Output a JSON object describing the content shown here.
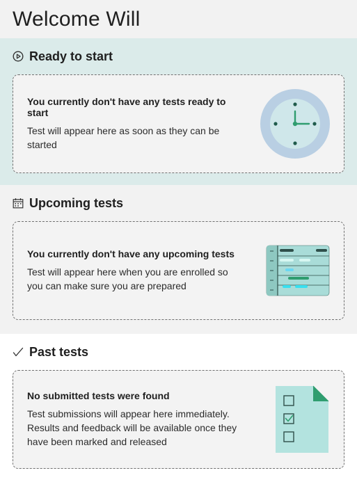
{
  "welcome": {
    "title": "Welcome Will"
  },
  "sections": {
    "ready": {
      "icon": "play-circle-icon",
      "heading": "Ready to start",
      "card_title": "You currently don't have any tests ready to start",
      "card_desc": "Test will appear here as soon as they can be started",
      "illustration": "clock-illustration"
    },
    "upcoming": {
      "icon": "calendar-icon",
      "heading": "Upcoming tests",
      "card_title": "You currently don't have any upcoming tests",
      "card_desc": "Test will appear here when you are enrolled so you can make sure you are prepared",
      "illustration": "schedule-illustration"
    },
    "past": {
      "icon": "checkmark-icon",
      "heading": "Past tests",
      "card_title": "No submitted tests were found",
      "card_desc": "Test submissions will appear here immediately. Results and feedback will be available once they have been marked and released",
      "illustration": "checklist-document-illustration"
    }
  },
  "colors": {
    "ready_bg": "#dbebea",
    "card_border": "#6f6f6f",
    "clock_ring": "#b9cfe3",
    "clock_face": "#cfe7ea",
    "accent_green": "#2f9d6f",
    "doc_fill": "#b3e3df",
    "doc_corner": "#2f9d6f"
  }
}
